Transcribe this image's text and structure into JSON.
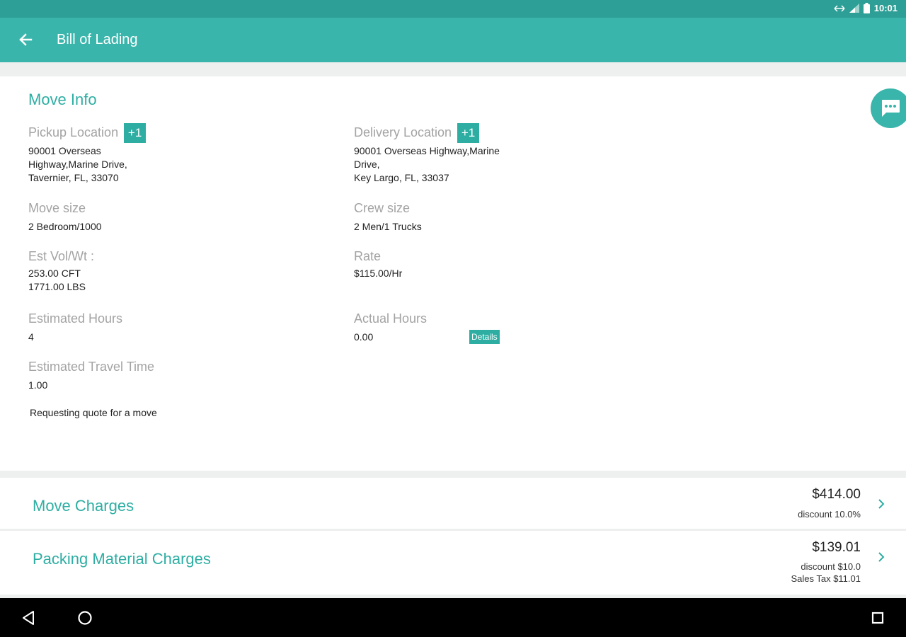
{
  "status_bar": {
    "time": "10:01"
  },
  "app_bar": {
    "title": "Bill of Lading"
  },
  "move_info": {
    "title": "Move Info",
    "pickup": {
      "label": "Pickup Location",
      "badge": "+1",
      "value": "90001 Overseas\nHighway,Marine Drive,\nTavernier, FL, 33070"
    },
    "delivery": {
      "label": "Delivery Location",
      "badge": "+1",
      "value": "90001 Overseas Highway,Marine\nDrive,\nKey Largo, FL, 33037"
    },
    "move_size": {
      "label": "Move size",
      "value": "2 Bedroom/1000"
    },
    "crew_size": {
      "label": "Crew size",
      "value": "2 Men/1 Trucks"
    },
    "est_vol": {
      "label": "Est Vol/Wt :",
      "value": "253.00 CFT\n1771.00 LBS"
    },
    "rate": {
      "label": "Rate",
      "value": "$115.00/Hr"
    },
    "est_hours": {
      "label": "Estimated Hours",
      "value": "4"
    },
    "actual_hours": {
      "label": "Actual Hours",
      "value": "0.00",
      "details_label": "Details"
    },
    "est_travel": {
      "label": "Estimated Travel Time",
      "value": "1.00"
    },
    "note": "Requesting quote for a move"
  },
  "move_charges": {
    "title": "Move Charges",
    "amount": "$414.00",
    "discount": "discount 10.0%"
  },
  "packing_charges": {
    "title": "Packing Material Charges",
    "amount": "$139.01",
    "discount": "discount $10.0",
    "tax": "Sales Tax $11.01"
  },
  "colors": {
    "accent": "#39b5ab",
    "status_bar": "#2e9f96",
    "text_accent": "#2eaea3"
  }
}
